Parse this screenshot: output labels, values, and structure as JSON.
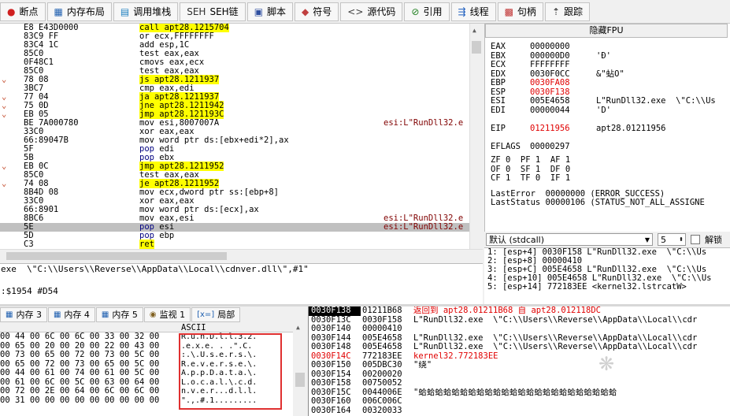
{
  "tabs": [
    {
      "icon": "●",
      "label": "断点",
      "color": "#d02020"
    },
    {
      "icon": "▦",
      "label": "内存布局",
      "color": "#2060b0"
    },
    {
      "icon": "▤",
      "label": "调用堆栈",
      "color": "#2080c0"
    },
    {
      "icon": "SEH",
      "label": "SEH链",
      "color": "#303030"
    },
    {
      "icon": "▣",
      "label": "脚本",
      "color": "#3050a0"
    },
    {
      "icon": "◆",
      "label": "符号",
      "color": "#c04040"
    },
    {
      "icon": "<>",
      "label": "源代码",
      "color": "#404040"
    },
    {
      "icon": "⊘",
      "label": "引用",
      "color": "#208020"
    },
    {
      "icon": "⇶",
      "label": "线程",
      "color": "#2060c0"
    },
    {
      "icon": "▩",
      "label": "句柄",
      "color": "#c03030"
    },
    {
      "icon": "⇡",
      "label": "跟踪",
      "color": "#303030"
    }
  ],
  "disasm": [
    {
      "mark": "",
      "bytes": "E8 E43D0000",
      "ins": "call apt28.1215704",
      "cmt": "",
      "type": "call"
    },
    {
      "mark": "",
      "bytes": "83C9 FF",
      "ins": "or ecx,FFFFFFFF",
      "cmt": ""
    },
    {
      "mark": "",
      "bytes": "83C4 1C",
      "ins": "add esp,1C",
      "cmt": ""
    },
    {
      "mark": "",
      "bytes": "85C0",
      "ins": "test eax,eax",
      "cmt": ""
    },
    {
      "mark": "",
      "bytes": "0F48C1",
      "ins": "cmovs eax,ecx",
      "cmt": ""
    },
    {
      "mark": "",
      "bytes": "85C0",
      "ins": "test eax,eax",
      "cmt": ""
    },
    {
      "mark": "⌄",
      "bytes": "78 08",
      "ins": "js apt28.1211937",
      "cmt": "",
      "type": "jmp"
    },
    {
      "mark": "",
      "bytes": "3BC7",
      "ins": "cmp eax,edi",
      "cmt": ""
    },
    {
      "mark": "⌄",
      "bytes": "77 04",
      "ins": "ja apt28.1211937",
      "cmt": "",
      "type": "jmp"
    },
    {
      "mark": "⌄",
      "bytes": "75 0D",
      "ins": "jne apt28.1211942",
      "cmt": "",
      "type": "jmp"
    },
    {
      "mark": "⌄",
      "bytes": "EB 05",
      "ins": "jmp apt28.121193C",
      "cmt": "",
      "type": "jmp"
    },
    {
      "mark": "",
      "bytes": "BE 7A000780",
      "ins": "mov esi,8007007A",
      "cmt": "esi:L\"RunDll32.e",
      "type": "mov"
    },
    {
      "mark": "",
      "bytes": "33C0",
      "ins": "xor eax,eax",
      "cmt": ""
    },
    {
      "mark": "",
      "bytes": "66:89047B",
      "ins": "mov word ptr ds:[ebx+edi*2],ax",
      "cmt": ""
    },
    {
      "mark": "",
      "bytes": "5F",
      "ins": "pop edi",
      "cmt": "",
      "type": "pop"
    },
    {
      "mark": "",
      "bytes": "5B",
      "ins": "pop ebx",
      "cmt": "",
      "type": "pop"
    },
    {
      "mark": "⌄",
      "bytes": "EB 0C",
      "ins": "jmp apt28.1211952",
      "cmt": "",
      "type": "jmp"
    },
    {
      "mark": "",
      "bytes": "85C0",
      "ins": "test eax,eax",
      "cmt": ""
    },
    {
      "mark": "⌄",
      "bytes": "74 08",
      "ins": "je apt28.1211952",
      "cmt": "",
      "type": "jmp"
    },
    {
      "mark": "",
      "bytes": "8B4D 08",
      "ins": "mov ecx,dword ptr ss:[ebp+8]",
      "cmt": ""
    },
    {
      "mark": "",
      "bytes": "33C0",
      "ins": "xor eax,eax",
      "cmt": ""
    },
    {
      "mark": "",
      "bytes": "66:8901",
      "ins": "mov word ptr ds:[ecx],ax",
      "cmt": ""
    },
    {
      "mark": "",
      "bytes": "8BC6",
      "ins": "mov eax,esi",
      "cmt": "esi:L\"RunDll32.e"
    },
    {
      "mark": "",
      "bytes": "5E",
      "ins": "pop esi",
      "cmt": "esi:L\"RunDll32.e",
      "type": "pop",
      "sel": true
    },
    {
      "mark": "",
      "bytes": "5D",
      "ins": "pop ebp",
      "cmt": "",
      "type": "pop"
    },
    {
      "mark": "",
      "bytes": "C3",
      "ins": "ret",
      "cmt": "",
      "type": "ret"
    }
  ],
  "info": {
    "line1": "exe  \\\"C:\\\\Users\\\\Reverse\\\\AppData\\\\Local\\\\cdnver.dll\\\",#1\"",
    "line2": "",
    "line3": ":$1954 #D54"
  },
  "regs": {
    "fpu_button": "隐藏FPU",
    "rows": [
      {
        "name": "EAX",
        "val": "00000000",
        "cmt": "",
        "red": false
      },
      {
        "name": "EBX",
        "val": "000000D0",
        "cmt": "'Đ'",
        "red": false
      },
      {
        "name": "ECX",
        "val": "FFFFFFFF",
        "cmt": "",
        "red": false
      },
      {
        "name": "EDX",
        "val": "0030F0CC",
        "cmt": "&\"蛅O\"",
        "red": false
      },
      {
        "name": "EBP",
        "val": "0030FA08",
        "cmt": "",
        "red": true
      },
      {
        "name": "ESP",
        "val": "0030F138",
        "cmt": "",
        "red": true
      },
      {
        "name": "ESI",
        "val": "005E4658",
        "cmt": "L\"RunDll32.exe  \\\"C:\\\\Us",
        "red": false
      },
      {
        "name": "EDI",
        "val": "00000044",
        "cmt": "'D'",
        "red": false
      },
      {
        "name": "",
        "val": "",
        "cmt": "",
        "red": false
      },
      {
        "name": "EIP",
        "val": "01211956",
        "cmt": "apt28.01211956",
        "red": true
      },
      {
        "name": "",
        "val": "",
        "cmt": "",
        "red": false
      },
      {
        "name": "EFLAGS",
        "val": "00000297",
        "cmt": "",
        "red": false
      }
    ],
    "flags": [
      "ZF 0  PF 1  AF 1",
      "OF 0  SF 1  DF 0",
      "CF 1  TF 0  IF 1"
    ],
    "last_error": "LastError  00000000 (ERROR_SUCCESS)",
    "last_status": "LastStatus 00000106 (STATUS_NOT_ALL_ASSIGNE"
  },
  "callconv": {
    "value": "默认 (stdcall)",
    "count": "5",
    "check_label": "解锁"
  },
  "args": [
    "1: [esp+4] 0030F158 L\"RunDll32.exe  \\\"C:\\\\Us",
    "2: [esp+8] 00000410",
    "3: [esp+C] 005E4658 L\"RunDll32.exe  \\\"C:\\\\Us",
    "4: [esp+10] 005E4658 L\"RunDll32.exe  \\\"C:\\\\Us",
    "5: [esp+14] 772183EE <kernel32.lstrcatW>"
  ],
  "memtabs": [
    {
      "label": "内存 3"
    },
    {
      "label": "内存 4"
    },
    {
      "label": "内存 5"
    },
    {
      "label": "监视 1"
    },
    {
      "label": "局部"
    }
  ],
  "dump": {
    "ascii_header": "ASCII",
    "rows": [
      {
        "hex": "00 44 00 6C 00 6C 00 33 00 32 00",
        "asc": "R.u.n.D.l.l.3.2."
      },
      {
        "hex": "00 65 00 20 00 20 00 22 00 43 00",
        "asc": ".e.x.e. . .\".C."
      },
      {
        "hex": "00 73 00 65 00 72 00 73 00 5C 00",
        "asc": ":.\\.U.s.e.r.s.\\."
      },
      {
        "hex": "00 65 00 72 00 73 00 65 00 5C 00",
        "asc": "R.e.v.e.r.s.e.\\."
      },
      {
        "hex": "00 44 00 61 00 74 00 61 00 5C 00",
        "asc": "A.p.p.D.a.t.a.\\."
      },
      {
        "hex": "00 61 00 6C 00 5C 00 63 00 64 00",
        "asc": "L.o.c.a.l.\\.c.d."
      },
      {
        "hex": "00 72 00 2E 00 64 00 6C 00 6C 00",
        "asc": "n.v.e.r...d.l.l."
      },
      {
        "hex": "00 31 00 00 00 00 00 00 00 00 00",
        "asc": "\".,.#.1........."
      }
    ]
  },
  "stack": [
    {
      "addr": "0030F138",
      "val": "01211B68",
      "cmt": "返回到 apt28.01211B68 自 apt28.012118DC",
      "sel": true,
      "red": true
    },
    {
      "addr": "0030F13C",
      "val": "0030F158",
      "cmt": "L\"RunDll32.exe  \\\"C:\\\\Users\\\\Reverse\\\\AppData\\\\Local\\\\cdr"
    },
    {
      "addr": "0030F140",
      "val": "00000410",
      "cmt": ""
    },
    {
      "addr": "0030F144",
      "val": "005E4658",
      "cmt": "L\"RunDll32.exe  \\\"C:\\\\Users\\\\Reverse\\\\AppData\\\\Local\\\\cdr"
    },
    {
      "addr": "0030F148",
      "val": "005E4658",
      "cmt": "L\"RunDll32.exe  \\\"C:\\\\Users\\\\Reverse\\\\AppData\\\\Local\\\\cdr"
    },
    {
      "addr": "0030F14C",
      "val": "772183EE",
      "cmt": "kernel32.772183EE",
      "red": true
    },
    {
      "addr": "0030F150",
      "val": "005DBC30",
      "cmt": "\"绕\""
    },
    {
      "addr": "0030F154",
      "val": "00200020",
      "cmt": ""
    },
    {
      "addr": "0030F158",
      "val": "00750052",
      "cmt": ""
    },
    {
      "addr": "0030F15C",
      "val": "0044006E",
      "cmt": "\"蛤蛤蛤蛤蛤蛤蛤蛤蛤蛤蛤蛤蛤蛤蛤蛤蛤蛤蛤蛤蛤蛤蛤蛤"
    },
    {
      "addr": "0030F160",
      "val": "006C006C",
      "cmt": ""
    },
    {
      "addr": "0030F164",
      "val": "00320033",
      "cmt": ""
    }
  ]
}
